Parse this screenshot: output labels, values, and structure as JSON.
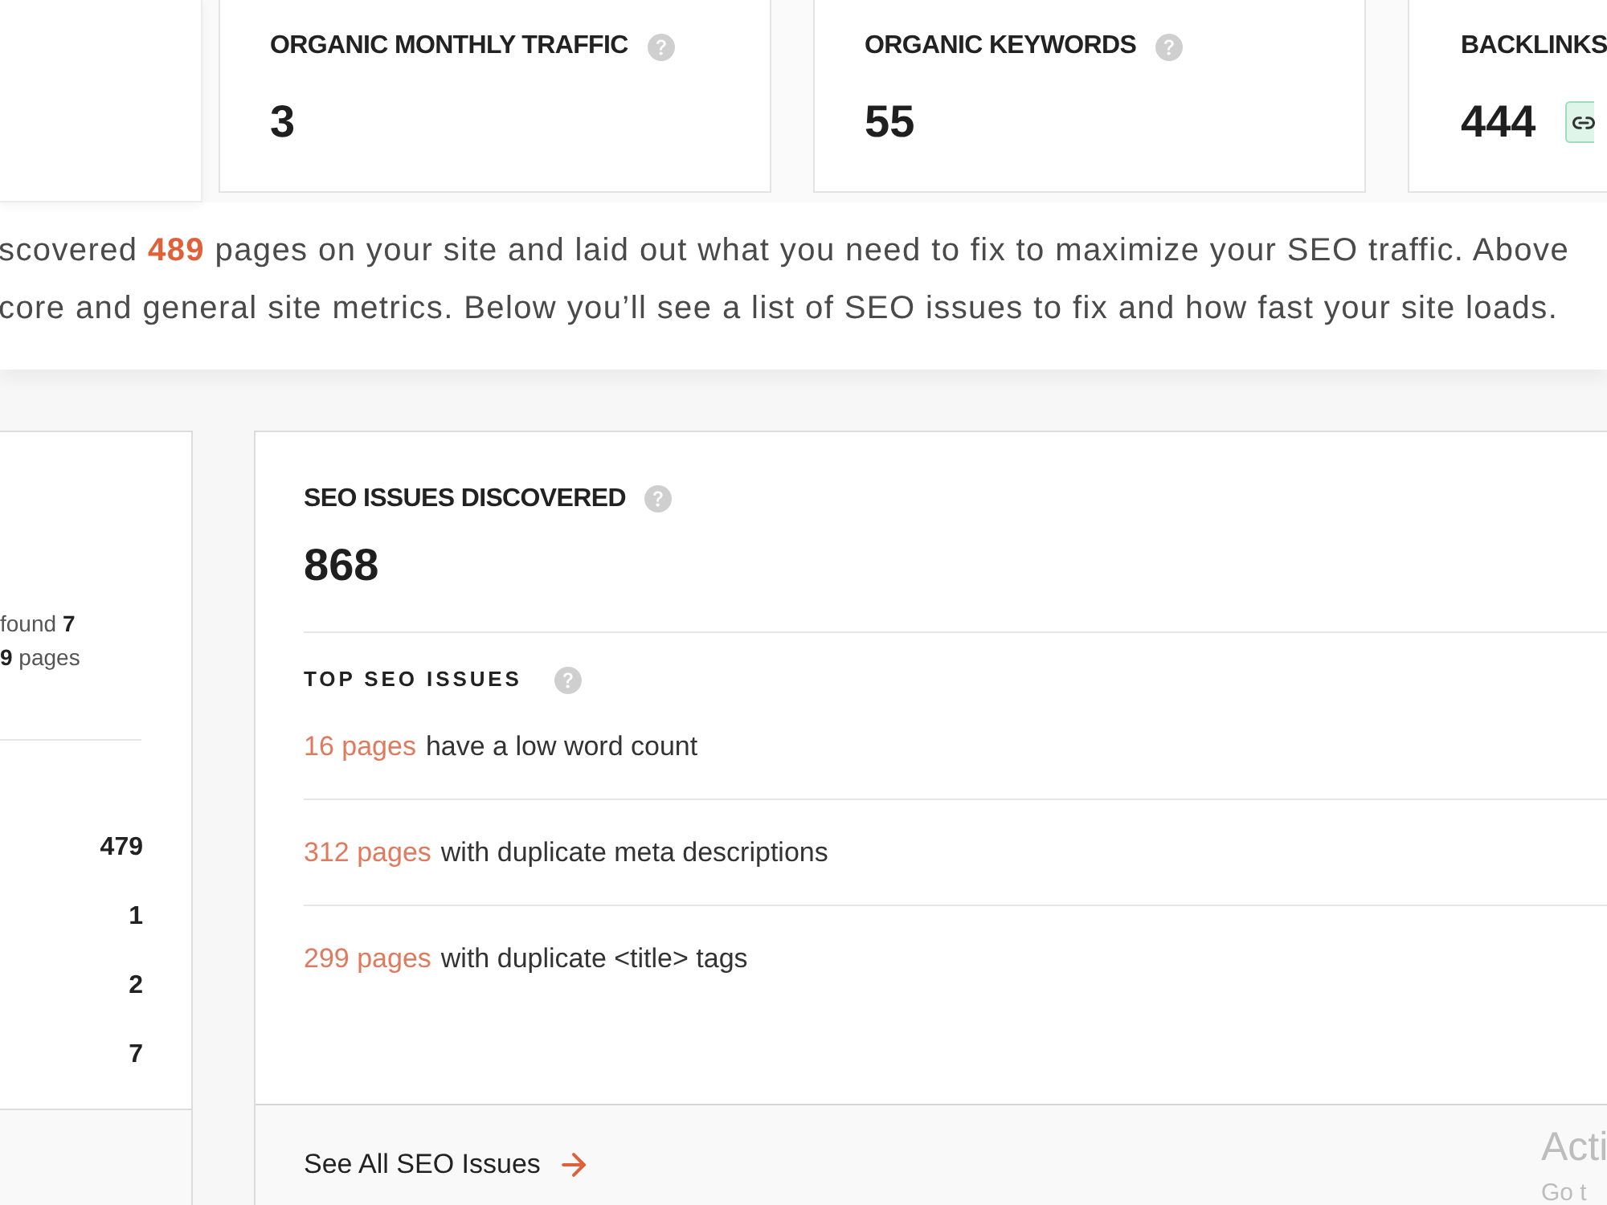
{
  "metric_cards": [
    {
      "kind": "help",
      "title": "ORGANIC MONTHLY TRAFFIC",
      "value": "3"
    },
    {
      "kind": "help",
      "title": "ORGANIC KEYWORDS",
      "value": "55"
    },
    {
      "kind": "linked",
      "title": "BACKLINKS",
      "value": "444"
    }
  ],
  "intro": {
    "lines": [
      "scovered **489** pages on your site and laid out what you need to fix to maximize your SEO traffic. Above",
      "core and general site metrics. Below you’ll see a list of SEO issues to fix and how fast your site loads."
    ]
  },
  "left_panel": {
    "summary_lines": [
      "found **7**",
      "**9** pages"
    ],
    "counts": [
      "479",
      "1",
      "2",
      "7"
    ]
  },
  "seo_issues": {
    "title": "SEO ISSUES DISCOVERED",
    "total": "868",
    "top_title": "TOP SEO ISSUES",
    "issues": [
      {
        "count": "16 pages",
        "text": "have a low word count"
      },
      {
        "count": "312 pages",
        "text": "with duplicate meta descriptions"
      },
      {
        "count": "299 pages",
        "text": "with duplicate <title> tags"
      }
    ],
    "footer_link": "See All SEO Issues"
  },
  "os_overlay": {
    "line_1": "Acti",
    "line_2": "Go t"
  }
}
